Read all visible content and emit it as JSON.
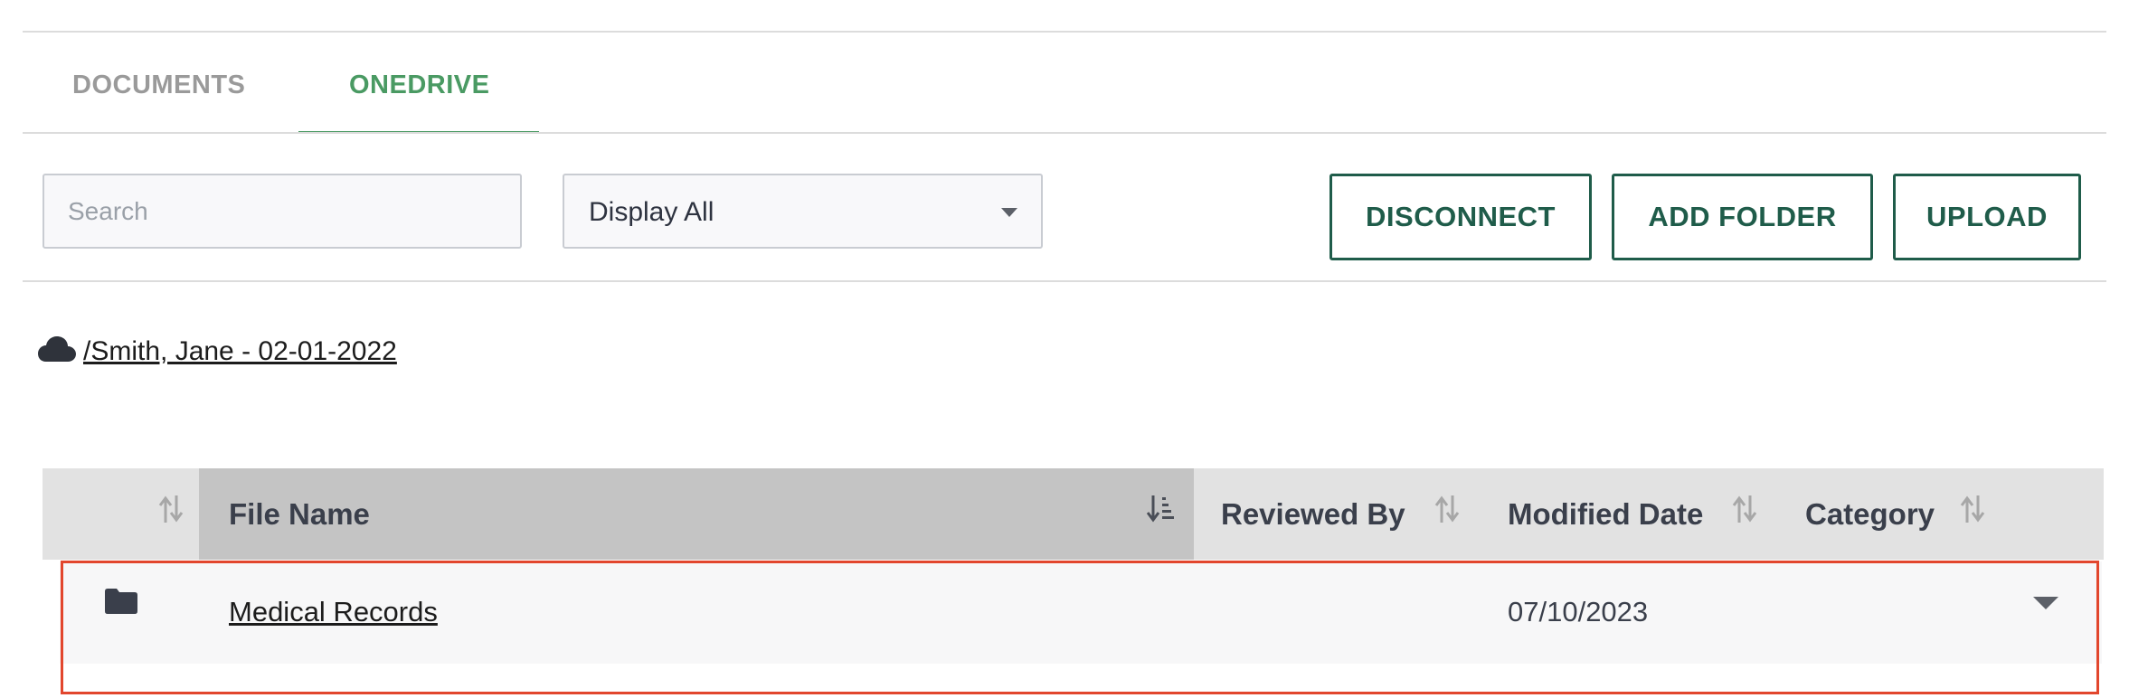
{
  "tabs": [
    {
      "label": "DOCUMENTS",
      "active": false
    },
    {
      "label": "ONEDRIVE",
      "active": true
    }
  ],
  "toolbar": {
    "search_placeholder": "Search",
    "search_value": "",
    "filter_selected": "Display All",
    "buttons": {
      "disconnect": "DISCONNECT",
      "add_folder": "ADD FOLDER",
      "upload": "UPLOAD"
    }
  },
  "breadcrumb": {
    "icon": "cloud-icon",
    "path": "/Smith, Jane - 02-01-2022"
  },
  "table": {
    "columns": [
      "File Name",
      "Reviewed By",
      "Modified Date",
      "Category"
    ],
    "sorted_column": "File Name",
    "rows": [
      {
        "icon": "folder-icon",
        "file_name": "Medical Records",
        "reviewed_by": "",
        "modified_date": "07/10/2023",
        "category": ""
      }
    ]
  },
  "colors": {
    "accent_green": "#4a9a63",
    "button_dark_green": "#1f5c4a",
    "highlight_red": "#e2462d"
  }
}
